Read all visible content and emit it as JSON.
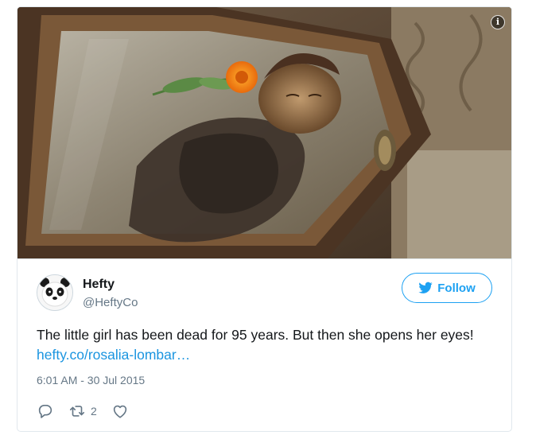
{
  "media": {
    "description_icon": "info-icon",
    "info_glyph": "i"
  },
  "author": {
    "name": "Hefty",
    "handle": "@HeftyCo",
    "avatar_icon": "panda-avatar"
  },
  "follow_button": {
    "label": "Follow",
    "icon": "twitter-bird-icon",
    "color": "#1da1f2"
  },
  "tweet": {
    "text": "The little girl has been dead for 95 years. But then she opens her eyes! ",
    "link_text": "hefty.co/rosalia-lombar…",
    "link_color": "#1b95e0",
    "timestamp": "6:01 AM - 30 Jul 2015"
  },
  "actions": {
    "reply_icon": "reply-icon",
    "retweet_icon": "retweet-icon",
    "retweet_count": "2",
    "like_icon": "heart-icon"
  }
}
